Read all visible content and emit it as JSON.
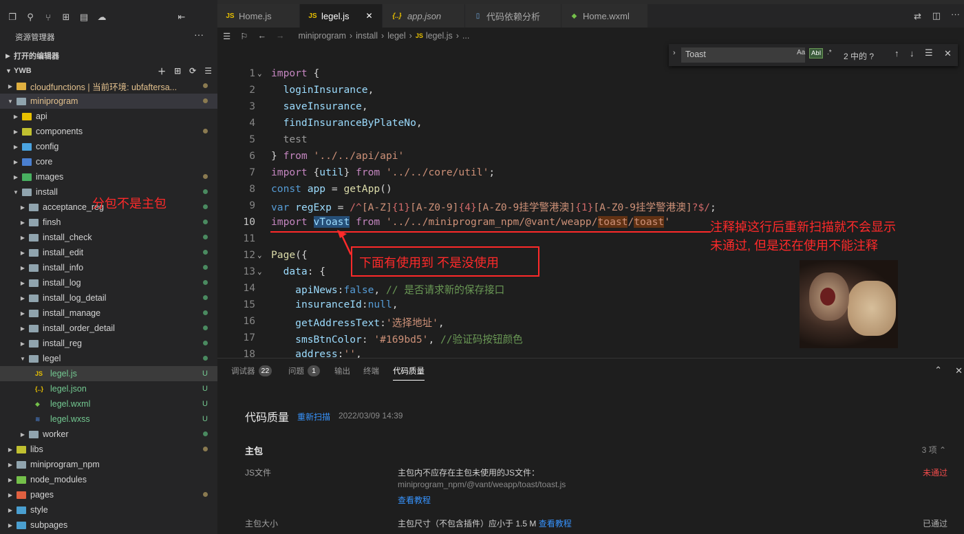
{
  "sidebar": {
    "title": "资源管理器",
    "more": "···",
    "open_editors": "打开的编辑器",
    "project": "YWB",
    "items": [
      {
        "label": "cloudfunctions | 当前环境: ubfaftersa...",
        "status": "●"
      },
      {
        "label": "miniprogram",
        "status": "●"
      },
      {
        "label": "api",
        "status": ""
      },
      {
        "label": "components",
        "status": "●"
      },
      {
        "label": "config",
        "status": ""
      },
      {
        "label": "core",
        "status": ""
      },
      {
        "label": "images",
        "status": "●"
      },
      {
        "label": "install",
        "status": "●"
      },
      {
        "label": "acceptance_reg",
        "status": "●"
      },
      {
        "label": "finsh",
        "status": "●"
      },
      {
        "label": "install_check",
        "status": "●"
      },
      {
        "label": "install_edit",
        "status": "●"
      },
      {
        "label": "install_info",
        "status": "●"
      },
      {
        "label": "install_log",
        "status": "●"
      },
      {
        "label": "install_log_detail",
        "status": "●"
      },
      {
        "label": "install_manage",
        "status": "●"
      },
      {
        "label": "install_order_detail",
        "status": "●"
      },
      {
        "label": "install_reg",
        "status": "●"
      },
      {
        "label": "legel",
        "status": "●"
      },
      {
        "label": "legel.js",
        "status": "U"
      },
      {
        "label": "legel.json",
        "status": "U"
      },
      {
        "label": "legel.wxml",
        "status": "U"
      },
      {
        "label": "legel.wxss",
        "status": "U"
      },
      {
        "label": "worker",
        "status": "●"
      },
      {
        "label": "libs",
        "status": "●"
      },
      {
        "label": "miniprogram_npm",
        "status": ""
      },
      {
        "label": "node_modules",
        "status": ""
      },
      {
        "label": "pages",
        "status": "●"
      },
      {
        "label": "style",
        "status": ""
      },
      {
        "label": "subpages",
        "status": ""
      }
    ]
  },
  "tabs": [
    {
      "label": "Home.js",
      "icon": "JS"
    },
    {
      "label": "legel.js",
      "icon": "JS",
      "close": "✕"
    },
    {
      "label": "app.json",
      "icon": "{..}"
    },
    {
      "label": "代码依赖分析",
      "icon": "📄"
    },
    {
      "label": "Home.wxml",
      "icon": "◆"
    }
  ],
  "breadcrumb": [
    "miniprogram",
    "install",
    "legel",
    "legel.js",
    "..."
  ],
  "find": {
    "value": "Toast",
    "aa": "Aa",
    "ab": "AbI",
    "re": ".*",
    "result": "2 中的 ?"
  },
  "editor": {
    "line_numbers": [
      "1",
      "2",
      "3",
      "4",
      "5",
      "6",
      "7",
      "8",
      "9",
      "10",
      "11",
      "12",
      "13",
      "14",
      "15",
      "16",
      "17",
      "18"
    ]
  },
  "panel": {
    "tabs": [
      "调试器",
      "问题",
      "输出",
      "终端",
      "代码质量"
    ],
    "debug_count": "22",
    "problem_count": "1",
    "heading": "代码质量",
    "rescan": "重新扫描",
    "timestamp": "2022/03/09 14:39",
    "group": "主包",
    "group_count": "3 项",
    "rows": [
      {
        "label": "JS文件",
        "desc": "主包内不应存在主包未使用的JS文件：",
        "path": "miniprogram_npm/@vant/weapp/toast/toast.js",
        "link": "查看教程",
        "status": "未通过"
      },
      {
        "label": "主包大小",
        "desc": "主包尺寸（不包含插件）应小于 1.5 M",
        "link": "查看教程",
        "status": "已通过"
      }
    ]
  },
  "annotations": {
    "a1": "分包不是主包",
    "a2": "下面有使用到 不是没使用",
    "a3": "注释掉这行后重新扫描就不会显示",
    "a4": "未通过, 但是还在使用不能注释"
  },
  "colors": {
    "accent": "#3794ff",
    "fail": "#f14c4c",
    "annotation": "#ff2a2a"
  }
}
